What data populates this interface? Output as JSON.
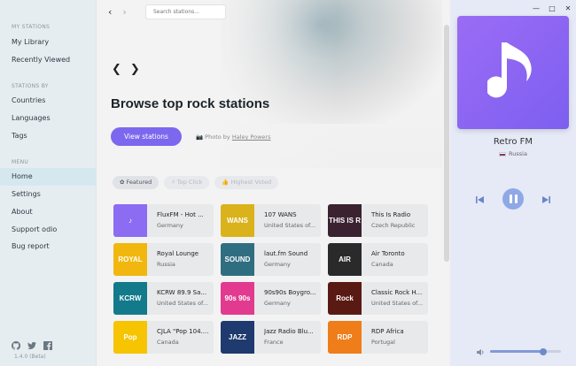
{
  "sidebar": {
    "sections": [
      {
        "title": "MY STATIONS",
        "items": [
          "My Library",
          "Recently Viewed"
        ]
      },
      {
        "title": "STATIONS BY",
        "items": [
          "Countries",
          "Languages",
          "Tags"
        ]
      },
      {
        "title": "MENU",
        "items": [
          "Home",
          "Settings",
          "About",
          "Support odio",
          "Bug report"
        ]
      }
    ],
    "active_item": "Home",
    "social_icons": [
      "github-icon",
      "twitter-icon",
      "facebook-icon"
    ],
    "version": "1.4.0 (Beta)"
  },
  "topbar": {
    "back": "‹",
    "forward": "›",
    "search_placeholder": "Search stations..."
  },
  "hero": {
    "title": "Browse top rock stations",
    "view_button": "View stations",
    "photo_prefix": "Photo by",
    "photo_author": "Haley Powers"
  },
  "filters": [
    {
      "label": "Featured",
      "icon": "paw-icon",
      "active": true
    },
    {
      "label": "Top Click",
      "icon": "bolt-icon",
      "active": false
    },
    {
      "label": "Highest Voted",
      "icon": "thumbs-up-icon",
      "active": false
    }
  ],
  "stations": [
    {
      "name": "FluxFM - Hot ...",
      "country": "Germany",
      "logo": "♪",
      "color": "#8b6cf3"
    },
    {
      "name": "107 WANS",
      "country": "United States of...",
      "logo": "WANS",
      "color": "#d9b21c"
    },
    {
      "name": "This Is Radio",
      "country": "Czech Republic",
      "logo": "THIS IS R",
      "color": "#3a2231"
    },
    {
      "name": "Royal Lounge",
      "country": "Russia",
      "logo": "ROYAL",
      "color": "#f1b70e"
    },
    {
      "name": "laut.fm Sound",
      "country": "Germany",
      "logo": "SOUND",
      "color": "#2f6e80"
    },
    {
      "name": "Air Toronto",
      "country": "Canada",
      "logo": "AIR",
      "color": "#2a2a2a"
    },
    {
      "name": "KCRW 89.9 Sa...",
      "country": "United States of...",
      "logo": "KCRW",
      "color": "#127a8a"
    },
    {
      "name": "90s90s Boygro...",
      "country": "Germany",
      "logo": "90s 90s",
      "color": "#e23a8f"
    },
    {
      "name": "Classic Rock H...",
      "country": "United States of...",
      "logo": "Rock",
      "color": "#5a1a14"
    },
    {
      "name": "CJLA \"Pop 104....",
      "country": "Canada",
      "logo": "Pop",
      "color": "#f6c400"
    },
    {
      "name": "Jazz Radio Blu...",
      "country": "France",
      "logo": "JAZZ",
      "color": "#1e3a6e"
    },
    {
      "name": "RDP Africa",
      "country": "Portugal",
      "logo": "RDP",
      "color": "#ef7d1a"
    }
  ],
  "player": {
    "station_name": "Retro FM",
    "station_country": "Russia",
    "volume": 0.75
  }
}
